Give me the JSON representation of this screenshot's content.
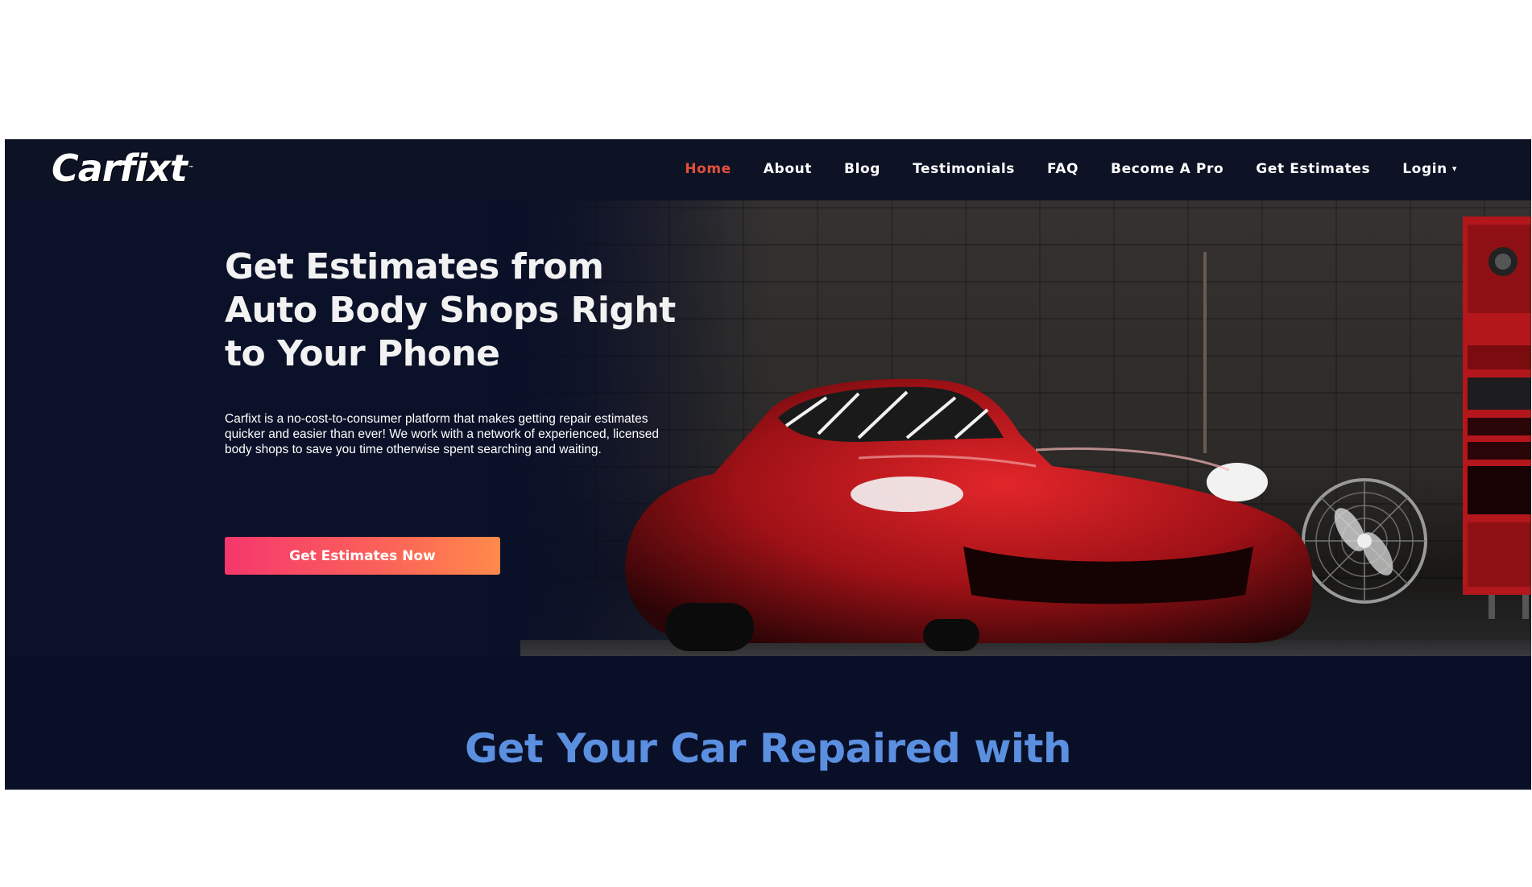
{
  "brand": {
    "logo_text": "Carfixt",
    "tm": "™"
  },
  "nav": {
    "items": [
      {
        "label": "Home",
        "active": true
      },
      {
        "label": "About",
        "active": false
      },
      {
        "label": "Blog",
        "active": false
      },
      {
        "label": "Testimonials",
        "active": false
      },
      {
        "label": "FAQ",
        "active": false
      },
      {
        "label": "Become A Pro",
        "active": false
      },
      {
        "label": "Get Estimates",
        "active": false
      },
      {
        "label": "Login",
        "active": false
      }
    ],
    "active_color": "#e3513b"
  },
  "hero": {
    "title_line1": "Get Estimates from",
    "title_line2": "Auto Body Shops Right",
    "title_line3": "to Your Phone",
    "description": "Carfixt is a no-cost-to-consumer platform that makes getting repair estimates quicker and easier than ever! We work with a network of experienced, licensed body shops to save you time otherwise spent searching and waiting.",
    "cta_label": "Get Estimates Now"
  },
  "section": {
    "title": "Get Your Car Repaired with"
  },
  "colors": {
    "background": "#090f26",
    "cta_gradient_start": "#f5376d",
    "cta_gradient_end": "#ff8a4a",
    "section_title": "#5b8fe0"
  },
  "icons": {
    "login_dropdown": "caret-down-icon"
  }
}
